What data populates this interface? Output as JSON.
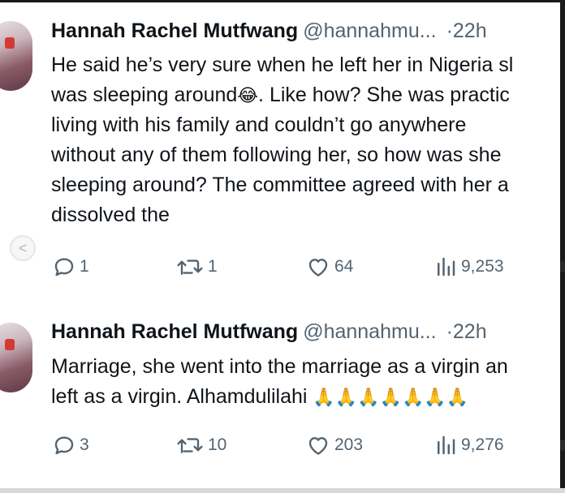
{
  "tweets": [
    {
      "name": "Hannah Rachel Mutfwang",
      "handle": "@hannahmu...",
      "separator": "·",
      "time": "22h",
      "lines": [
        "He said he’s very sure when he left her in Nigeria sl",
        "was sleeping around",
        ". Like how? She was practic",
        "living with his family and couldn’t go anywhere",
        "without any of them following her, so how was she",
        "sleeping around? The committee agreed with her a",
        "dissolved the"
      ],
      "emoji": "😂",
      "replies": "1",
      "retweets": "1",
      "likes": "64",
      "views": "9,253"
    },
    {
      "name": "Hannah Rachel Mutfwang",
      "handle": "@hannahmu...",
      "separator": "·",
      "time": "22h",
      "lines": [
        "Marriage, she went into the marriage as a virgin an",
        "left as a virgin. Alhamdulilahi "
      ],
      "emoji": "🙏🙏🙏🙏🙏🙏🙏",
      "replies": "3",
      "retweets": "10",
      "likes": "203",
      "views": "9,276"
    }
  ],
  "nav": {
    "back_glyph": "<"
  },
  "colors": {
    "text": "#0f1419",
    "muted": "#536471",
    "background": "#ffffff"
  }
}
